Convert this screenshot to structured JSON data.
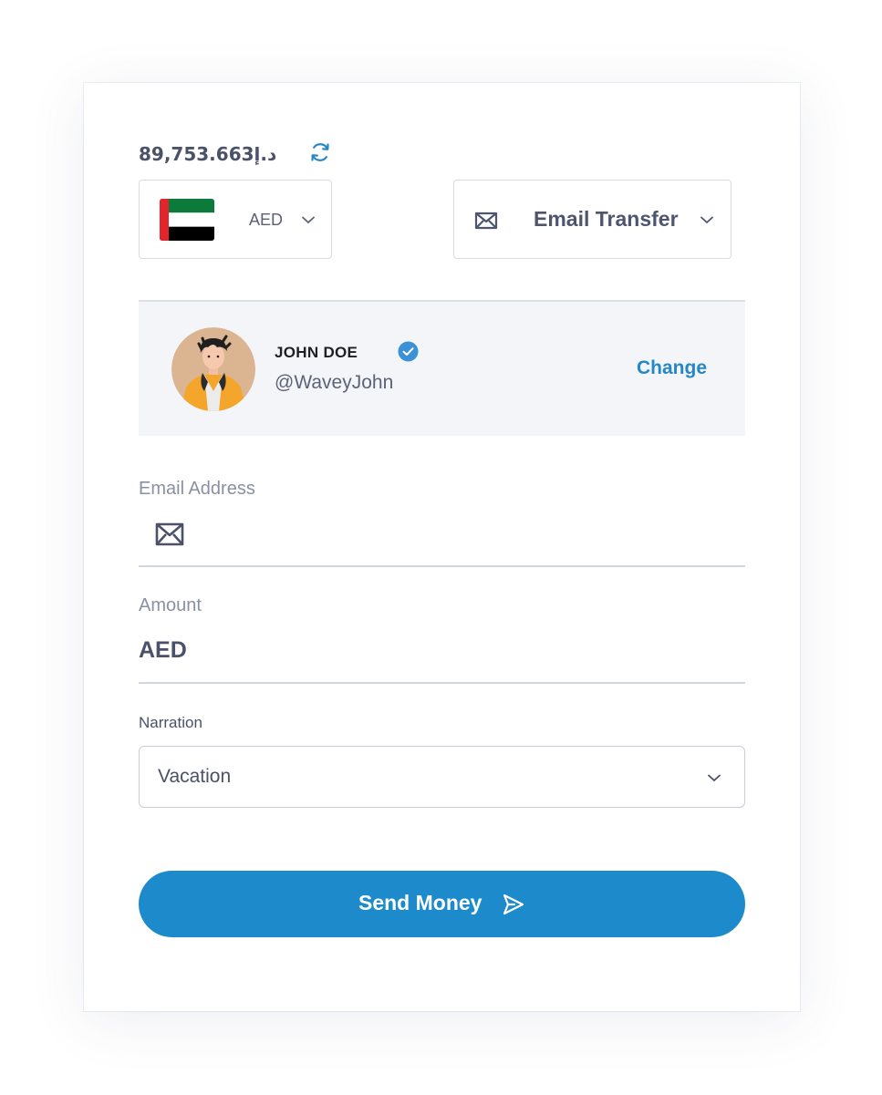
{
  "balance": {
    "amount": "89,753.663د.إ",
    "refresh_icon": "refresh-icon"
  },
  "currency": {
    "code": "AED",
    "flag": "uae-flag-icon"
  },
  "transfer_method": {
    "label": "Email Transfer",
    "icon": "envelope-icon"
  },
  "recipient": {
    "name": "JOHN DOE",
    "handle": "@WaveyJohn",
    "verified": true,
    "change_label": "Change"
  },
  "email_field": {
    "label": "Email Address",
    "value": "",
    "icon": "envelope-icon"
  },
  "amount_field": {
    "label": "Amount",
    "prefix": "AED"
  },
  "narration": {
    "label": "Narration",
    "selected": "Vacation"
  },
  "send_button": {
    "label": "Send Money",
    "icon": "send-icon"
  },
  "colors": {
    "accent": "#1d8bcb",
    "link": "#2587c7",
    "text": "#4a5168",
    "muted": "#8a90a3",
    "panel": "#f4f5f9"
  }
}
